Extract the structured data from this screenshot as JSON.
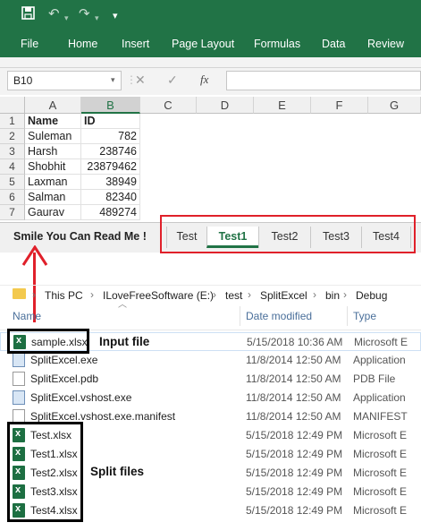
{
  "excel": {
    "ribbon_tabs": [
      "File",
      "Home",
      "Insert",
      "Page Layout",
      "Formulas",
      "Data",
      "Review"
    ],
    "name_box": "B10",
    "fx_label": "fx",
    "columns": [
      "A",
      "B",
      "C",
      "D",
      "E",
      "F",
      "G"
    ],
    "rows": [
      {
        "num": "1",
        "name": "Name",
        "id": "ID"
      },
      {
        "num": "2",
        "name": "Suleman",
        "id": "782"
      },
      {
        "num": "3",
        "name": "Harsh",
        "id": "238746"
      },
      {
        "num": "4",
        "name": "Shobhit",
        "id": "23879462"
      },
      {
        "num": "5",
        "name": "Laxman",
        "id": "38949"
      },
      {
        "num": "6",
        "name": "Salman",
        "id": "82340"
      },
      {
        "num": "7",
        "name": "Gaurav",
        "id": "489274"
      }
    ],
    "sheet_label": "Smile You Can Read Me !",
    "sheet_tabs": [
      "Test",
      "Test1",
      "Test2",
      "Test3",
      "Test4"
    ],
    "active_tab": "Test1"
  },
  "explorer": {
    "breadcrumb": [
      "This PC",
      "ILoveFreeSoftware (E:)",
      "test",
      "SplitExcel",
      "bin",
      "Debug"
    ],
    "headers": {
      "name": "Name",
      "date": "Date modified",
      "type": "Type"
    },
    "files": [
      {
        "name": "sample.xlsx",
        "date": "5/15/2018 10:36 AM",
        "type": "Microsoft E",
        "icon": "excel-file-icon"
      },
      {
        "name": "SplitExcel.exe",
        "date": "11/8/2014 12:50 AM",
        "type": "Application",
        "icon": "exe-file-icon"
      },
      {
        "name": "SplitExcel.pdb",
        "date": "11/8/2014 12:50 AM",
        "type": "PDB File",
        "icon": "page-file-icon"
      },
      {
        "name": "SplitExcel.vshost.exe",
        "date": "11/8/2014 12:50 AM",
        "type": "Application",
        "icon": "exe-file-icon"
      },
      {
        "name": "SplitExcel.vshost.exe.manifest",
        "date": "11/8/2014 12:50 AM",
        "type": "MANIFEST",
        "icon": "page-file-icon"
      },
      {
        "name": "Test.xlsx",
        "date": "5/15/2018 12:49 PM",
        "type": "Microsoft E",
        "icon": "excel-file-icon"
      },
      {
        "name": "Test1.xlsx",
        "date": "5/15/2018 12:49 PM",
        "type": "Microsoft E",
        "icon": "excel-file-icon"
      },
      {
        "name": "Test2.xlsx",
        "date": "5/15/2018 12:49 PM",
        "type": "Microsoft E",
        "icon": "excel-file-icon"
      },
      {
        "name": "Test3.xlsx",
        "date": "5/15/2018 12:49 PM",
        "type": "Microsoft E",
        "icon": "excel-file-icon"
      },
      {
        "name": "Test4.xlsx",
        "date": "5/15/2018 12:49 PM",
        "type": "Microsoft E",
        "icon": "excel-file-icon"
      }
    ]
  },
  "annotations": {
    "input_file": "Input file",
    "split_files": "Split files"
  },
  "colors": {
    "excel_green": "#217346",
    "annotation_red": "#e0202a",
    "annotation_black": "#000000"
  }
}
